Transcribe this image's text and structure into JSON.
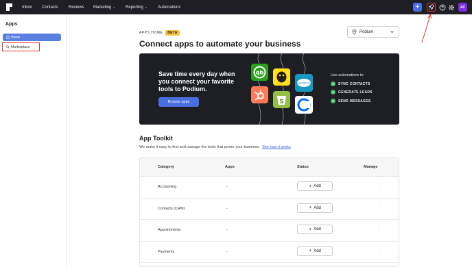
{
  "topbar": {
    "nav": [
      {
        "label": "Inbox"
      },
      {
        "label": "Contacts"
      },
      {
        "label": "Reviews"
      },
      {
        "label": "Marketing"
      },
      {
        "label": "Reporting"
      },
      {
        "label": "Automations"
      }
    ],
    "avatar_initials": "AC",
    "accent": "#4a6ee0",
    "highlight_color": "#e2382f"
  },
  "sidebar": {
    "title": "Apps",
    "items": [
      {
        "label": "Home",
        "icon": "home-icon",
        "active": true
      },
      {
        "label": "Marketplace",
        "icon": "search-icon",
        "active": false
      }
    ]
  },
  "header": {
    "eyebrow": "APPS HOME",
    "badge": "BETA",
    "title": "Connect apps to automate your business",
    "location": "Podium"
  },
  "banner": {
    "headline": "Save time every day when you connect your favorite tools to Podium.",
    "button": "Browse apps",
    "subtitle": "Use automations to:",
    "checks": [
      "SYNC CONTACTS",
      "GENERATE LEADS",
      "SEND MESSAGES"
    ],
    "logos": [
      "quickbooks-logo",
      "mailchimp-logo",
      "salesforce-logo",
      "hubspot-logo",
      "shopify-logo",
      "calendly-logo"
    ]
  },
  "toolkit": {
    "title": "App Toolkit",
    "description": "We make it easy to find and manage the tools that power your business.",
    "link": "See how it works",
    "columns": [
      "Category",
      "Apps",
      "Status",
      "Manage"
    ],
    "rows": [
      {
        "category": "Accounting",
        "apps": "-",
        "status": "Add"
      },
      {
        "category": "Contacts (CRM)",
        "apps": "-",
        "status": "Add"
      },
      {
        "category": "Appointments",
        "apps": "-",
        "status": "Add"
      },
      {
        "category": "Payments",
        "apps": "-",
        "status": "Add"
      }
    ]
  }
}
